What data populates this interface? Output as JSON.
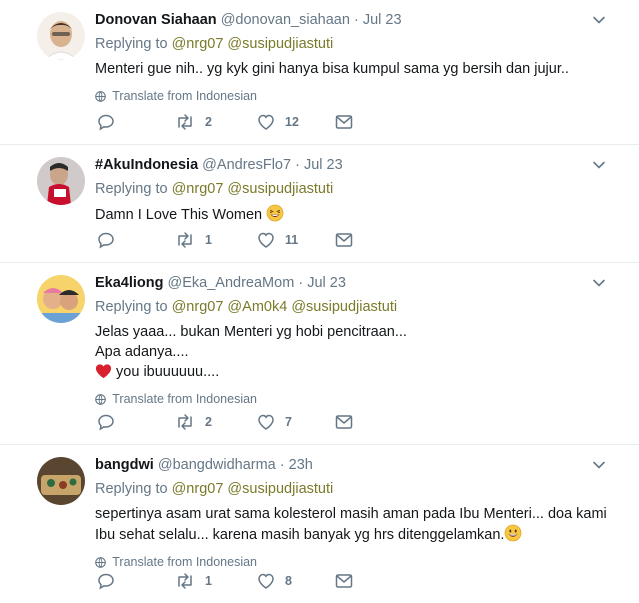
{
  "tweets": [
    {
      "name": "Donovan Siahaan",
      "handle": "@donovan_siahaan",
      "dot": "·",
      "time": "Jul 23",
      "replying_label": "Replying to",
      "mentions": [
        "@nrg07",
        "@susipudjiastuti"
      ],
      "text_lines": [
        "Menteri gue nih.. yg kyk gini hanya bisa kumpul sama yg bersih dan jujur.."
      ],
      "translate": "Translate from Indonesian",
      "reply_count": "",
      "retweet_count": "2",
      "like_count": "12",
      "avatar_colors": [
        "#f4efe9",
        "#3a2a22",
        "#d9b28f"
      ]
    },
    {
      "name": "#AkuIndonesia",
      "handle": "@AndresFlo7",
      "dot": "·",
      "time": "Jul 23",
      "replying_label": "Replying to",
      "mentions": [
        "@nrg07",
        "@susipudjiastuti"
      ],
      "text_lines": [
        "Damn I Love This Women"
      ],
      "emoji_icon": "grinning-squint-emoji",
      "translate": "",
      "reply_count": "",
      "retweet_count": "1",
      "like_count": "11",
      "avatar_colors": [
        "#e9e4e4",
        "#c8102e",
        "#2b2b2b"
      ]
    },
    {
      "name": "Eka4liong",
      "handle": "@Eka_AndreaMom",
      "dot": "·",
      "time": "Jul 23",
      "replying_label": "Replying to",
      "mentions": [
        "@nrg07",
        "@Am0k4",
        "@susipudjiastuti"
      ],
      "text_lines": [
        "Jelas yaaa... bukan Menteri yg hobi pencitraan...",
        "Apa adanya....",
        "you ibuuuuuu...."
      ],
      "heart_emoji_icon": "red-heart-emoji",
      "translate": "Translate from Indonesian",
      "reply_count": "",
      "retweet_count": "2",
      "like_count": "7",
      "avatar_colors": [
        "#f6d36b",
        "#e97aa0",
        "#6aa2d8"
      ]
    },
    {
      "name": "bangdwi",
      "handle": "@bangdwidharma",
      "dot": "·",
      "time": "23h",
      "replying_label": "Replying to",
      "mentions": [
        "@nrg07",
        "@susipudjiastuti"
      ],
      "text_lines": [
        "sepertinya asam urat sama kolesterol masih aman pada Ibu Menteri... doa kami",
        "Ibu sehat selalu... karena masih banyak yg hrs ditenggelamkan."
      ],
      "emoji_icon": "grinning-emoji",
      "translate": "Translate from Indonesian",
      "reply_count": "",
      "retweet_count": "1",
      "like_count": "8",
      "avatar_colors": [
        "#5a4630",
        "#c7a56a",
        "#2e6b3e"
      ]
    }
  ],
  "icons": {
    "reply": "reply-icon",
    "retweet": "retweet-icon",
    "like": "heart-icon",
    "message": "envelope-icon",
    "more": "chevron-down-icon",
    "globe": "globe-icon"
  },
  "colors": {
    "name": "#14171a",
    "meta": "#657786",
    "mention": "#7a7a2a",
    "divider": "#e6ecf0"
  }
}
